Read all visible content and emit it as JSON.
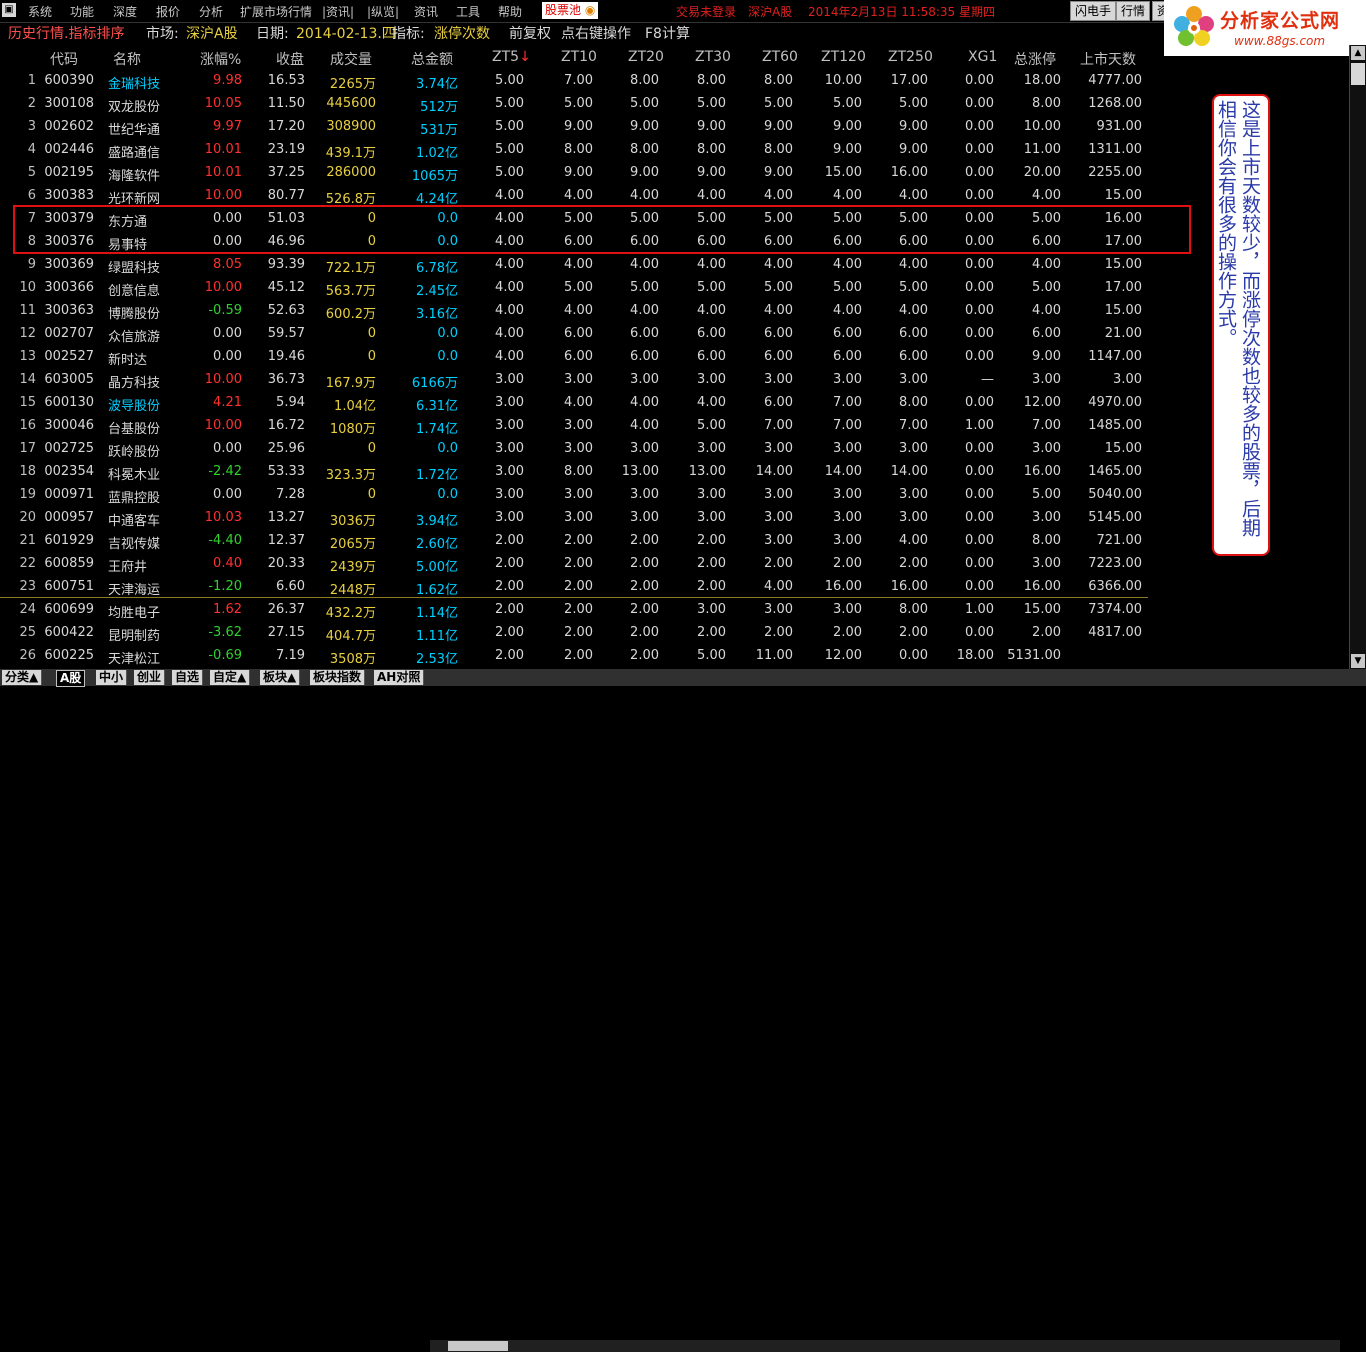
{
  "menu": {
    "items": [
      "系统",
      "功能",
      "深度",
      "报价",
      "分析",
      "扩展市场行情",
      "|资讯|",
      "|纵览|",
      "资讯",
      "工具",
      "帮助"
    ],
    "active": "股票池",
    "status_login": "交易未登录",
    "status_market": "深沪A股",
    "status_time": "2014年2月13日  11:58:35 星期四",
    "btn_flash": "闪电手",
    "btn_quote": "行情",
    "btn_more": "资"
  },
  "logo": {
    "name": "分析家公式网",
    "url": "www.88gs.com"
  },
  "title": {
    "mode": "历史行情.指标排序",
    "market_label": "市场:",
    "market_value": "深沪A股",
    "date_label": "日期:",
    "date_value": "2014-02-13.四",
    "ind_label": "指标:",
    "ind_value": "涨停次数",
    "adjust": "前复权",
    "hint": "点右键操作",
    "f8": "F8计算"
  },
  "columns": [
    "",
    "代码",
    "名称",
    "涨幅%",
    "收盘",
    "成交量",
    "总金额",
    "ZT5",
    "ZT10",
    "ZT20",
    "ZT30",
    "ZT60",
    "ZT120",
    "ZT250",
    "XG1",
    "总涨停",
    "上市天数"
  ],
  "sort_arrow": "↓",
  "rows": [
    {
      "n": "1",
      "code": "600390",
      "name": "金瑞科技",
      "nc": "#00d0ff",
      "chg": "9.98",
      "cc": "#ff3030",
      "close": "16.53",
      "vol": "2265万",
      "amt": "3.74亿",
      "zt": [
        "5.00",
        "7.00",
        "8.00",
        "8.00",
        "8.00",
        "10.00",
        "17.00",
        "0.00",
        "18.00",
        "4777.00"
      ]
    },
    {
      "n": "2",
      "code": "300108",
      "name": "双龙股份",
      "nc": "#d8d8d8",
      "chg": "10.05",
      "cc": "#ff3030",
      "close": "11.50",
      "vol": "445600",
      "amt": "512万",
      "zt": [
        "5.00",
        "5.00",
        "5.00",
        "5.00",
        "5.00",
        "5.00",
        "5.00",
        "0.00",
        "8.00",
        "1268.00"
      ]
    },
    {
      "n": "3",
      "code": "002602",
      "name": "世纪华通",
      "nc": "#d8d8d8",
      "chg": "9.97",
      "cc": "#ff3030",
      "close": "17.20",
      "vol": "308900",
      "amt": "531万",
      "zt": [
        "5.00",
        "9.00",
        "9.00",
        "9.00",
        "9.00",
        "9.00",
        "9.00",
        "0.00",
        "10.00",
        "931.00"
      ]
    },
    {
      "n": "4",
      "code": "002446",
      "name": "盛路通信",
      "nc": "#d8d8d8",
      "chg": "10.01",
      "cc": "#ff3030",
      "close": "23.19",
      "vol": "439.1万",
      "amt": "1.02亿",
      "zt": [
        "5.00",
        "8.00",
        "8.00",
        "8.00",
        "8.00",
        "9.00",
        "9.00",
        "0.00",
        "11.00",
        "1311.00"
      ]
    },
    {
      "n": "5",
      "code": "002195",
      "name": "海隆软件",
      "nc": "#d8d8d8",
      "chg": "10.01",
      "cc": "#ff3030",
      "close": "37.25",
      "vol": "286000",
      "amt": "1065万",
      "zt": [
        "5.00",
        "9.00",
        "9.00",
        "9.00",
        "9.00",
        "15.00",
        "16.00",
        "0.00",
        "20.00",
        "2255.00"
      ]
    },
    {
      "n": "6",
      "code": "300383",
      "name": "光环新网",
      "nc": "#d8d8d8",
      "chg": "10.00",
      "cc": "#ff3030",
      "close": "80.77",
      "vol": "526.8万",
      "amt": "4.24亿",
      "zt": [
        "4.00",
        "4.00",
        "4.00",
        "4.00",
        "4.00",
        "4.00",
        "4.00",
        "0.00",
        "4.00",
        "15.00"
      ]
    },
    {
      "n": "7",
      "code": "300379",
      "name": "东方通",
      "nc": "#d8d8d8",
      "chg": "0.00",
      "cc": "#d8d8d8",
      "close": "51.03",
      "vol": "0",
      "amt": "0.0",
      "zt": [
        "4.00",
        "5.00",
        "5.00",
        "5.00",
        "5.00",
        "5.00",
        "5.00",
        "0.00",
        "5.00",
        "16.00"
      ]
    },
    {
      "n": "8",
      "code": "300376",
      "name": "易事特",
      "nc": "#d8d8d8",
      "chg": "0.00",
      "cc": "#d8d8d8",
      "close": "46.96",
      "vol": "0",
      "amt": "0.0",
      "zt": [
        "4.00",
        "6.00",
        "6.00",
        "6.00",
        "6.00",
        "6.00",
        "6.00",
        "0.00",
        "6.00",
        "17.00"
      ]
    },
    {
      "n": "9",
      "code": "300369",
      "name": "绿盟科技",
      "nc": "#d8d8d8",
      "chg": "8.05",
      "cc": "#ff3030",
      "close": "93.39",
      "vol": "722.1万",
      "amt": "6.78亿",
      "zt": [
        "4.00",
        "4.00",
        "4.00",
        "4.00",
        "4.00",
        "4.00",
        "4.00",
        "0.00",
        "4.00",
        "15.00"
      ]
    },
    {
      "n": "10",
      "code": "300366",
      "name": "创意信息",
      "nc": "#d8d8d8",
      "chg": "10.00",
      "cc": "#ff3030",
      "close": "45.12",
      "vol": "563.7万",
      "amt": "2.45亿",
      "zt": [
        "4.00",
        "5.00",
        "5.00",
        "5.00",
        "5.00",
        "5.00",
        "5.00",
        "0.00",
        "5.00",
        "17.00"
      ]
    },
    {
      "n": "11",
      "code": "300363",
      "name": "博腾股份",
      "nc": "#d8d8d8",
      "chg": "-0.59",
      "cc": "#30d030",
      "close": "52.63",
      "vol": "600.2万",
      "amt": "3.16亿",
      "zt": [
        "4.00",
        "4.00",
        "4.00",
        "4.00",
        "4.00",
        "4.00",
        "4.00",
        "0.00",
        "4.00",
        "15.00"
      ]
    },
    {
      "n": "12",
      "code": "002707",
      "name": "众信旅游",
      "nc": "#d8d8d8",
      "chg": "0.00",
      "cc": "#d8d8d8",
      "close": "59.57",
      "vol": "0",
      "amt": "0.0",
      "zt": [
        "4.00",
        "6.00",
        "6.00",
        "6.00",
        "6.00",
        "6.00",
        "6.00",
        "0.00",
        "6.00",
        "21.00"
      ]
    },
    {
      "n": "13",
      "code": "002527",
      "name": "新时达",
      "nc": "#d8d8d8",
      "chg": "0.00",
      "cc": "#d8d8d8",
      "close": "19.46",
      "vol": "0",
      "amt": "0.0",
      "zt": [
        "4.00",
        "6.00",
        "6.00",
        "6.00",
        "6.00",
        "6.00",
        "6.00",
        "0.00",
        "9.00",
        "1147.00"
      ]
    },
    {
      "n": "14",
      "code": "603005",
      "name": "晶方科技",
      "nc": "#d8d8d8",
      "chg": "10.00",
      "cc": "#ff3030",
      "close": "36.73",
      "vol": "167.9万",
      "amt": "6166万",
      "zt": [
        "3.00",
        "3.00",
        "3.00",
        "3.00",
        "3.00",
        "3.00",
        "3.00",
        "—",
        "3.00",
        "3.00"
      ]
    },
    {
      "n": "15",
      "code": "600130",
      "name": "波导股份",
      "nc": "#00d0ff",
      "chg": "4.21",
      "cc": "#ff3030",
      "close": "5.94",
      "vol": "1.04亿",
      "amt": "6.31亿",
      "zt": [
        "3.00",
        "4.00",
        "4.00",
        "4.00",
        "6.00",
        "7.00",
        "8.00",
        "0.00",
        "12.00",
        "4970.00"
      ]
    },
    {
      "n": "16",
      "code": "300046",
      "name": "台基股份",
      "nc": "#d8d8d8",
      "chg": "10.00",
      "cc": "#ff3030",
      "close": "16.72",
      "vol": "1080万",
      "amt": "1.74亿",
      "zt": [
        "3.00",
        "3.00",
        "4.00",
        "5.00",
        "7.00",
        "7.00",
        "7.00",
        "1.00",
        "7.00",
        "1485.00"
      ]
    },
    {
      "n": "17",
      "code": "002725",
      "name": "跃岭股份",
      "nc": "#d8d8d8",
      "chg": "0.00",
      "cc": "#d8d8d8",
      "close": "25.96",
      "vol": "0",
      "amt": "0.0",
      "zt": [
        "3.00",
        "3.00",
        "3.00",
        "3.00",
        "3.00",
        "3.00",
        "3.00",
        "0.00",
        "3.00",
        "15.00"
      ]
    },
    {
      "n": "18",
      "code": "002354",
      "name": "科冕木业",
      "nc": "#d8d8d8",
      "chg": "-2.42",
      "cc": "#30d030",
      "close": "53.33",
      "vol": "323.3万",
      "amt": "1.72亿",
      "zt": [
        "3.00",
        "8.00",
        "13.00",
        "13.00",
        "14.00",
        "14.00",
        "14.00",
        "0.00",
        "16.00",
        "1465.00"
      ]
    },
    {
      "n": "19",
      "code": "000971",
      "name": "蓝鼎控股",
      "nc": "#d8d8d8",
      "chg": "0.00",
      "cc": "#d8d8d8",
      "close": "7.28",
      "vol": "0",
      "amt": "0.0",
      "zt": [
        "3.00",
        "3.00",
        "3.00",
        "3.00",
        "3.00",
        "3.00",
        "3.00",
        "0.00",
        "5.00",
        "5040.00"
      ]
    },
    {
      "n": "20",
      "code": "000957",
      "name": "中通客车",
      "nc": "#d8d8d8",
      "chg": "10.03",
      "cc": "#ff3030",
      "close": "13.27",
      "vol": "3036万",
      "amt": "3.94亿",
      "zt": [
        "3.00",
        "3.00",
        "3.00",
        "3.00",
        "3.00",
        "3.00",
        "3.00",
        "0.00",
        "3.00",
        "5145.00"
      ]
    },
    {
      "n": "21",
      "code": "601929",
      "name": "吉视传媒",
      "nc": "#d8d8d8",
      "chg": "-4.40",
      "cc": "#30d030",
      "close": "12.37",
      "vol": "2065万",
      "amt": "2.60亿",
      "zt": [
        "2.00",
        "2.00",
        "2.00",
        "2.00",
        "3.00",
        "3.00",
        "4.00",
        "0.00",
        "8.00",
        "721.00"
      ]
    },
    {
      "n": "22",
      "code": "600859",
      "name": "王府井",
      "nc": "#d8d8d8",
      "chg": "0.40",
      "cc": "#ff3030",
      "close": "20.33",
      "vol": "2439万",
      "amt": "5.00亿",
      "zt": [
        "2.00",
        "2.00",
        "2.00",
        "2.00",
        "2.00",
        "2.00",
        "2.00",
        "0.00",
        "3.00",
        "7223.00"
      ]
    },
    {
      "n": "23",
      "code": "600751",
      "name": "天津海运",
      "nc": "#d8d8d8",
      "chg": "-1.20",
      "cc": "#30d030",
      "close": "6.60",
      "vol": "2448万",
      "amt": "1.62亿",
      "zt": [
        "2.00",
        "2.00",
        "2.00",
        "2.00",
        "4.00",
        "16.00",
        "16.00",
        "0.00",
        "16.00",
        "6366.00"
      ]
    },
    {
      "n": "24",
      "code": "600699",
      "name": "均胜电子",
      "nc": "#d8d8d8",
      "chg": "1.62",
      "cc": "#ff3030",
      "close": "26.37",
      "vol": "432.2万",
      "amt": "1.14亿",
      "zt": [
        "2.00",
        "2.00",
        "2.00",
        "3.00",
        "3.00",
        "3.00",
        "8.00",
        "1.00",
        "15.00",
        "7374.00"
      ]
    },
    {
      "n": "25",
      "code": "600422",
      "name": "昆明制药",
      "nc": "#d8d8d8",
      "chg": "-3.62",
      "cc": "#30d030",
      "close": "27.15",
      "vol": "404.7万",
      "amt": "1.11亿",
      "zt": [
        "2.00",
        "2.00",
        "2.00",
        "2.00",
        "2.00",
        "2.00",
        "2.00",
        "0.00",
        "2.00",
        "4817.00"
      ]
    },
    {
      "n": "26",
      "code": "600225",
      "name": "天津松江",
      "nc": "#d8d8d8",
      "chg": "-0.69",
      "cc": "#30d030",
      "close": "7.19",
      "vol": "3508万",
      "amt": "2.53亿",
      "zt": [
        "2.00",
        "2.00",
        "2.00",
        "5.00",
        "11.00",
        "12.00",
        "0.00",
        "18.00",
        "5131.00",
        ""
      ]
    }
  ],
  "note": "这是上市天数较少，而涨停次数也较多的股票，后期相信你会有很多的操作方式。",
  "tabs": [
    "分类▲",
    "A股",
    "中小",
    "创业",
    "自选",
    "自定▲",
    "板块▲",
    "板块指数",
    "AH对照"
  ],
  "active_tab": "A股",
  "colors": {
    "vol": "#e8d040",
    "amt": "#00d0ff",
    "up": "#ff3030",
    "down": "#30d030",
    "title_red": "#ff5050",
    "title_yellow": "#e8d040"
  }
}
